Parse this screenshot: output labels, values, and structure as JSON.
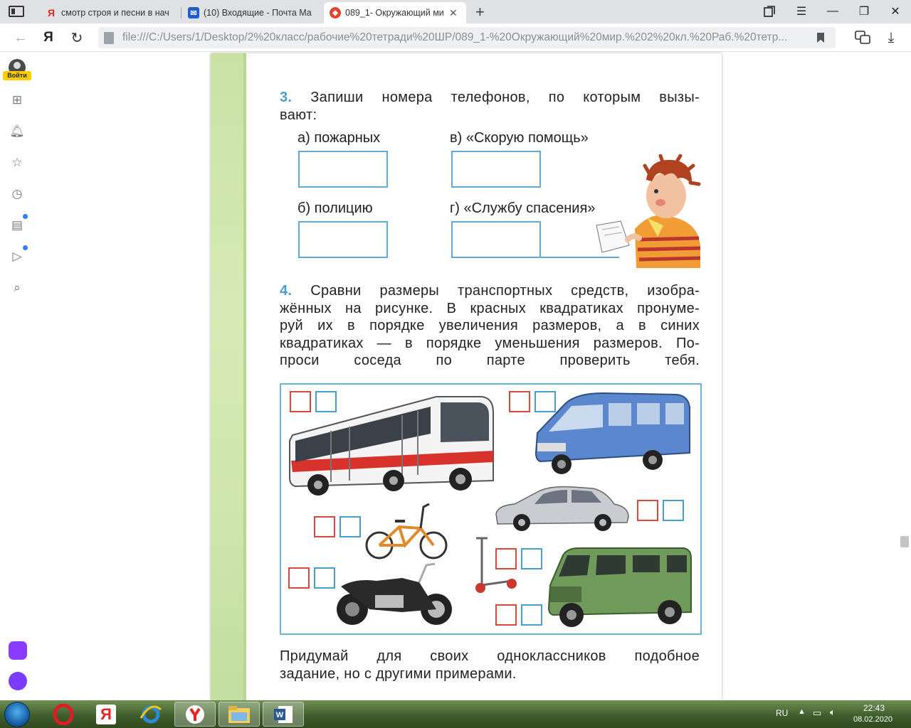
{
  "browser": {
    "tabs": [
      {
        "title": "смотр строя и песни в нач",
        "favicon": "yandex-icon",
        "active": false
      },
      {
        "title": "(10) Входящие - Почта Ма",
        "favicon": "mail-icon",
        "active": false
      },
      {
        "title": "089_1- Окружающий ми",
        "favicon": "pdf-icon",
        "active": true
      }
    ],
    "address": {
      "yandex_logo": "Я",
      "url": "file:///C:/Users/1/Desktop/2%20класс/рабочие%20тетради%20ШР/089_1-%20Окружающий%20мир.%202%20кл.%20Раб.%20тетр..."
    },
    "sidebar": {
      "login_label": "Войти"
    }
  },
  "document": {
    "task3": {
      "number": "3.",
      "line1": "Запиши номера телефонов, по которым вызы-",
      "line2": "вают:",
      "items": [
        {
          "label": "а) пожарных"
        },
        {
          "label": "в) «Скорую помощь»"
        },
        {
          "label": "б) полицию"
        },
        {
          "label": "г) «Службу спасения»"
        }
      ]
    },
    "task4": {
      "number": "4.",
      "lines": [
        "Сравни размеры транспортных средств, изобра-",
        "жённых на рисунке. В красных квадратиках пронуме-",
        "руй их в порядке увеличения размеров, а в синих",
        "квадратиках — в порядке уменьшения размеров. По-",
        "проси соседа по парте проверить тебя."
      ],
      "vehicles": [
        "bus",
        "minibus",
        "car",
        "bicycle",
        "motorcycle",
        "scooter",
        "suv"
      ]
    },
    "footer": {
      "line1": "Придумай для своих одноклассников подобное",
      "line2": "задание, но с другими примерами."
    }
  },
  "taskbar": {
    "apps": [
      "opera-icon",
      "yandex-icon",
      "ie-icon",
      "yandex-browser-icon",
      "explorer-icon",
      "word-icon"
    ],
    "language": "RU",
    "time": "22:43",
    "date": "08.02.2020"
  },
  "colors": {
    "task_number": "#4a9ecd",
    "red_square": "#d9473d",
    "blue_square": "#4a9ecd",
    "page_strip": "#cfe6ad"
  }
}
